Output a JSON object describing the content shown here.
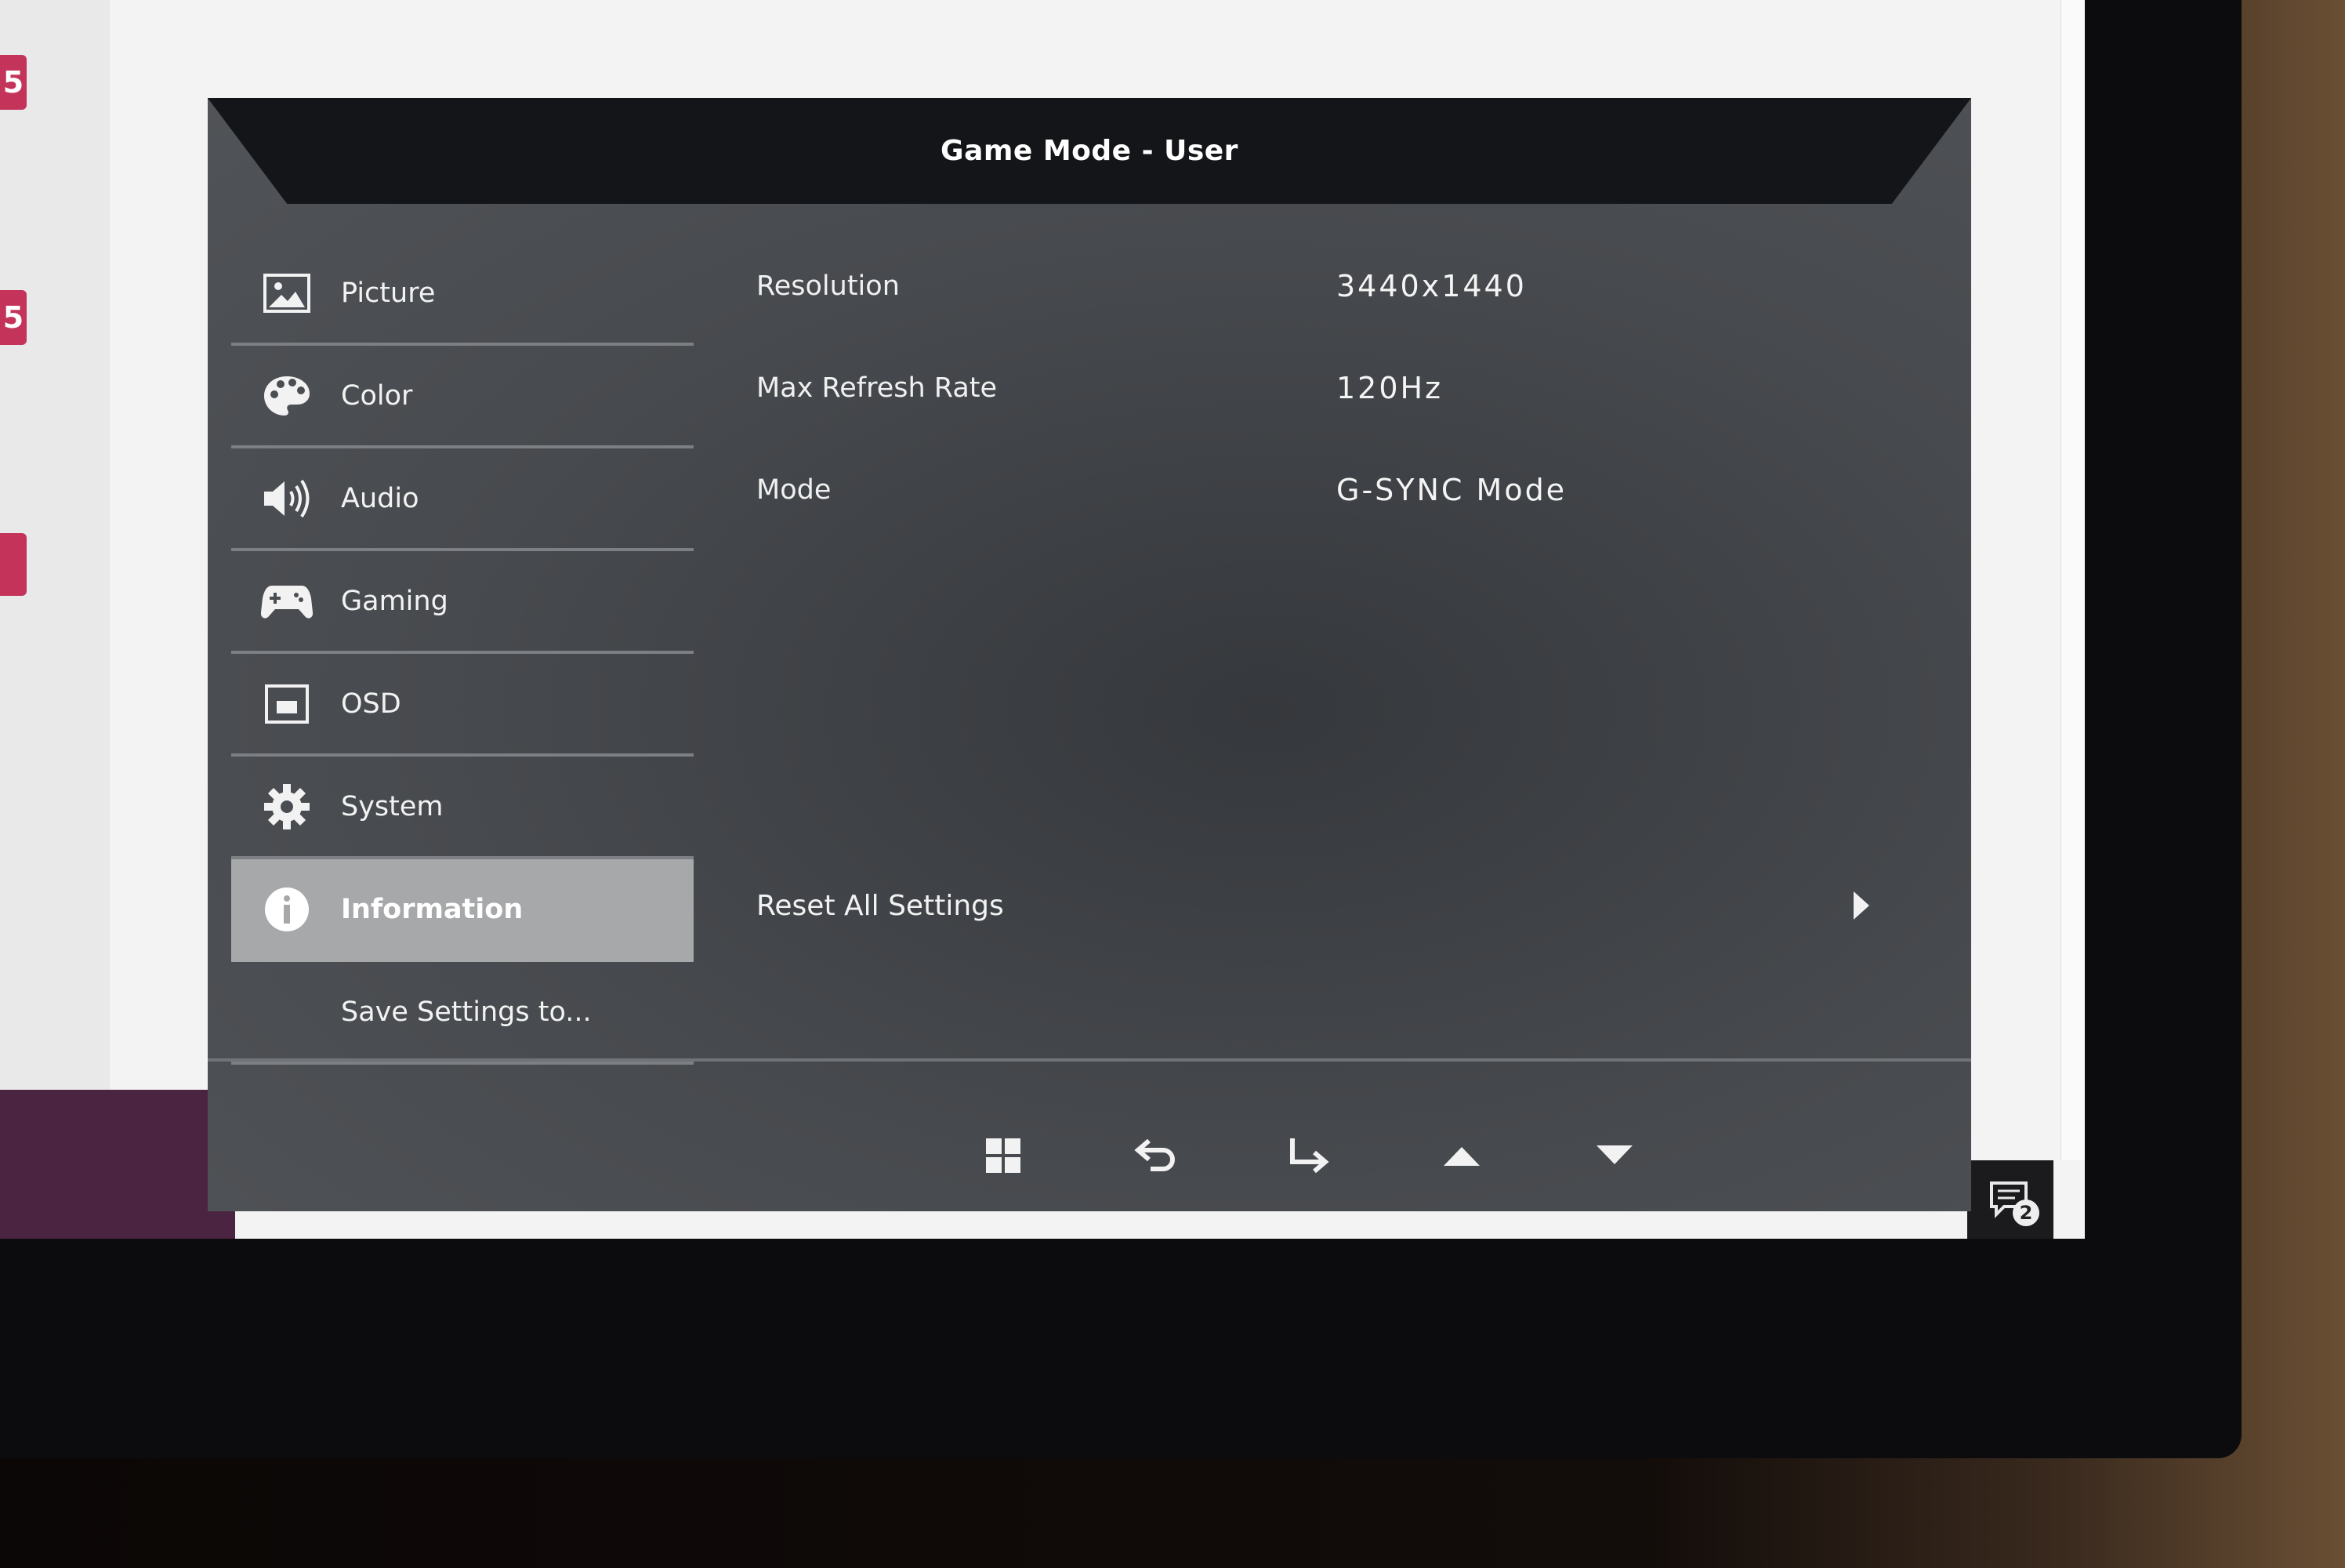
{
  "osd": {
    "title": "Game Mode - User",
    "menu": [
      {
        "label": "Picture",
        "icon": "picture-icon"
      },
      {
        "label": "Color",
        "icon": "palette-icon"
      },
      {
        "label": "Audio",
        "icon": "speaker-icon"
      },
      {
        "label": "Gaming",
        "icon": "gamepad-icon"
      },
      {
        "label": "OSD",
        "icon": "osd-icon"
      },
      {
        "label": "System",
        "icon": "gear-icon"
      },
      {
        "label": "Information",
        "icon": "info-icon",
        "active": true
      },
      {
        "label": "Save Settings to..."
      }
    ],
    "info": {
      "resolution_label": "Resolution",
      "resolution_value": "3440x1440",
      "refresh_label": "Max Refresh Rate",
      "refresh_value": "120Hz",
      "mode_label": "Mode",
      "mode_value": "G-SYNC Mode",
      "reset_label": "Reset All Settings"
    },
    "footer_icons": [
      "menu-grid-icon",
      "back-icon",
      "enter-icon",
      "up-arrow-icon",
      "down-arrow-icon"
    ]
  },
  "desktop": {
    "tag_1": "5",
    "tag_2": "5",
    "notification_count": "2"
  },
  "colors": {
    "osd_background": "#47494d",
    "header": "#141518",
    "active_item": "#a7a8aa",
    "accent_tag": "#c4345a"
  }
}
